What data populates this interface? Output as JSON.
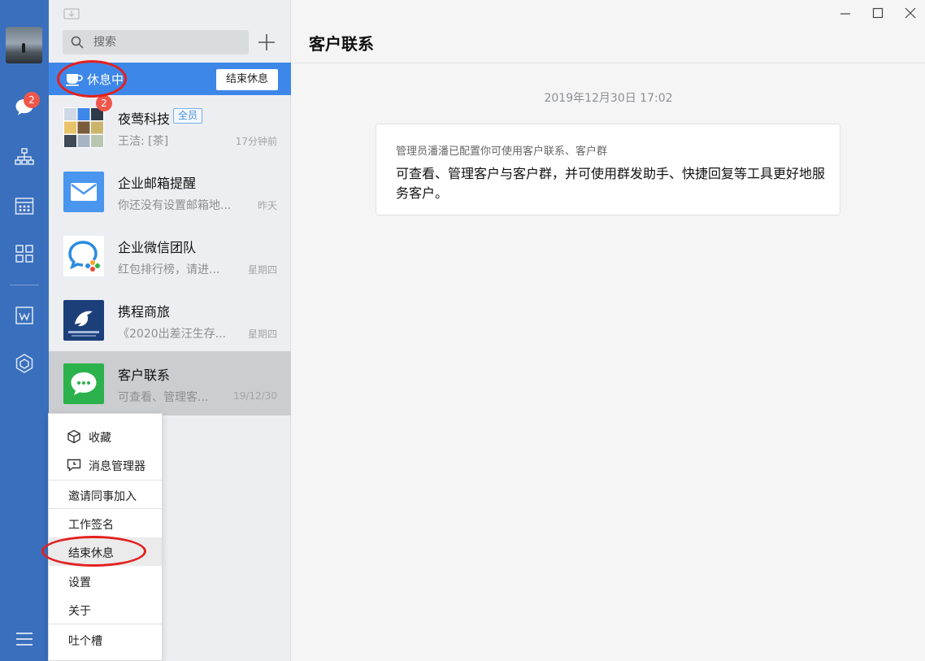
{
  "rail": {
    "unread_badge": "2"
  },
  "list": {
    "search_placeholder": "搜索",
    "rest_status": "休息中",
    "end_rest_button": "结束休息",
    "conversations": [
      {
        "name": "夜莺科技",
        "tag": "全员",
        "preview": "王洁: [茶]",
        "time": "17分钟前",
        "badge": "2"
      },
      {
        "name": "企业邮箱提醒",
        "preview": "你还没有设置邮箱地...",
        "time": "昨天"
      },
      {
        "name": "企业微信团队",
        "preview": "红包排行榜，请进...",
        "time": "星期四"
      },
      {
        "name": "携程商旅",
        "preview": "《2020出差汪生存...",
        "time": "星期四"
      },
      {
        "name": "客户联系",
        "preview": "可查看、管理客...",
        "time": "19/12/30"
      }
    ]
  },
  "menu": {
    "items": [
      "收藏",
      "消息管理器",
      "邀请同事加入",
      "工作签名",
      "结束休息",
      "设置",
      "关于",
      "吐个槽"
    ]
  },
  "main": {
    "title": "客户联系",
    "date": "2019年12月30日 17:02",
    "card_sub": "管理员潘潘已配置你可使用客户联系、客户群",
    "card_body": "可查看、管理客户与客户群，并可使用群发助手、快捷回复等工具更好地服务客户。"
  },
  "colors": {
    "rail": "#3a6fbd",
    "accent": "#3d87e8",
    "badge": "#f0564a",
    "annotation": "#e3211f"
  }
}
